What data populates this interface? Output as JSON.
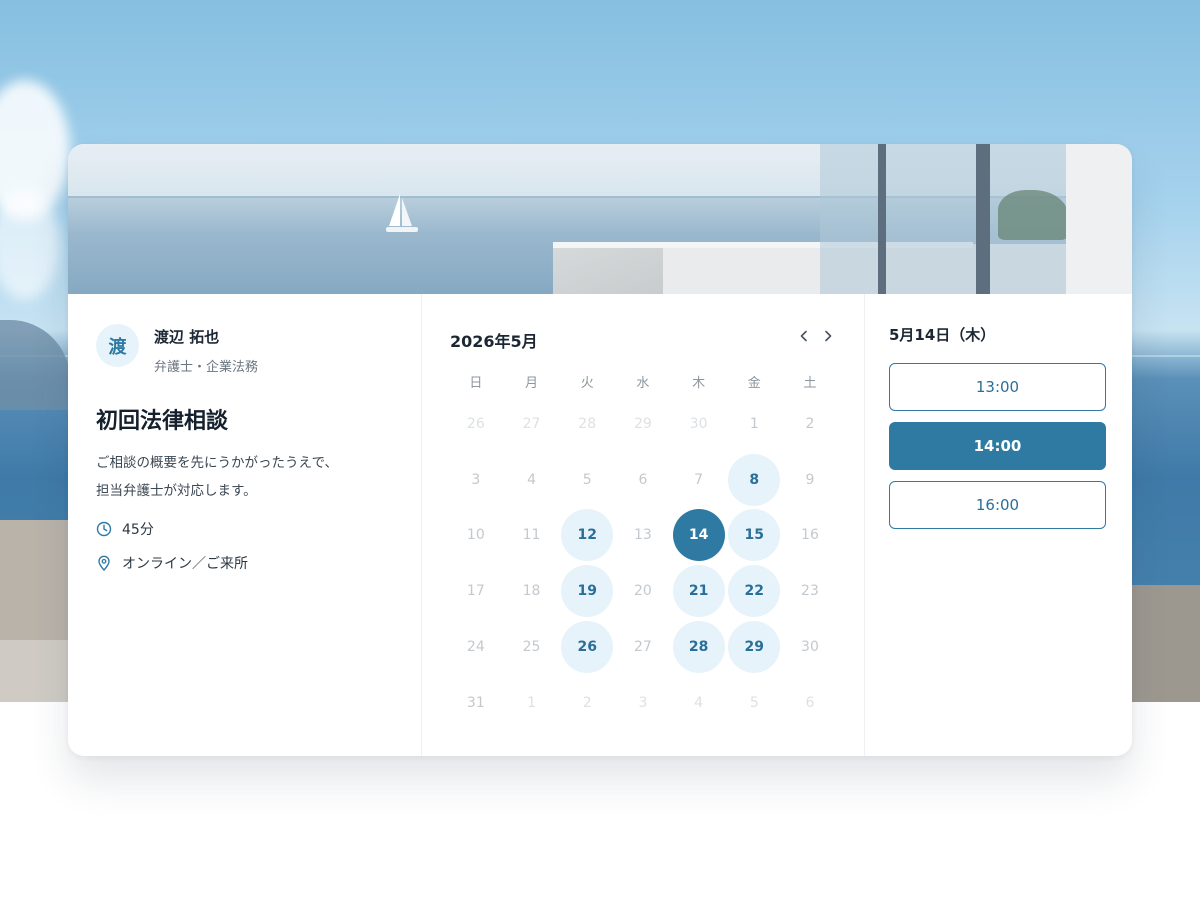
{
  "host": {
    "avatar_initial": "渡",
    "name": "渡辺 拓也",
    "role": "弁護士・企業法務"
  },
  "event": {
    "title": "初回法律相談",
    "description_line1": "ご相談の概要を先にうかがったうえで、",
    "description_line2": "担当弁護士が対応します。",
    "duration": "45分",
    "location": "オンライン／ご来所"
  },
  "calendar": {
    "month_label": "2026年5月",
    "weekdays": [
      "日",
      "月",
      "火",
      "水",
      "木",
      "金",
      "土"
    ],
    "weeks": [
      [
        {
          "d": "26",
          "s": "muted"
        },
        {
          "d": "27",
          "s": "muted"
        },
        {
          "d": "28",
          "s": "muted"
        },
        {
          "d": "29",
          "s": "muted"
        },
        {
          "d": "30",
          "s": "muted"
        },
        {
          "d": "1",
          "s": "off"
        },
        {
          "d": "2",
          "s": "off"
        }
      ],
      [
        {
          "d": "3",
          "s": "off"
        },
        {
          "d": "4",
          "s": "off"
        },
        {
          "d": "5",
          "s": "off"
        },
        {
          "d": "6",
          "s": "off"
        },
        {
          "d": "7",
          "s": "off"
        },
        {
          "d": "8",
          "s": "avail"
        },
        {
          "d": "9",
          "s": "off"
        }
      ],
      [
        {
          "d": "10",
          "s": "off"
        },
        {
          "d": "11",
          "s": "off"
        },
        {
          "d": "12",
          "s": "avail"
        },
        {
          "d": "13",
          "s": "off"
        },
        {
          "d": "14",
          "s": "selected"
        },
        {
          "d": "15",
          "s": "avail"
        },
        {
          "d": "16",
          "s": "off"
        }
      ],
      [
        {
          "d": "17",
          "s": "off"
        },
        {
          "d": "18",
          "s": "off"
        },
        {
          "d": "19",
          "s": "avail"
        },
        {
          "d": "20",
          "s": "off"
        },
        {
          "d": "21",
          "s": "avail"
        },
        {
          "d": "22",
          "s": "avail"
        },
        {
          "d": "23",
          "s": "off"
        }
      ],
      [
        {
          "d": "24",
          "s": "off"
        },
        {
          "d": "25",
          "s": "off"
        },
        {
          "d": "26",
          "s": "avail"
        },
        {
          "d": "27",
          "s": "off"
        },
        {
          "d": "28",
          "s": "avail"
        },
        {
          "d": "29",
          "s": "avail"
        },
        {
          "d": "30",
          "s": "off"
        }
      ],
      [
        {
          "d": "31",
          "s": "off"
        },
        {
          "d": "1",
          "s": "muted"
        },
        {
          "d": "2",
          "s": "muted"
        },
        {
          "d": "3",
          "s": "muted"
        },
        {
          "d": "4",
          "s": "muted"
        },
        {
          "d": "5",
          "s": "muted"
        },
        {
          "d": "6",
          "s": "muted"
        }
      ]
    ]
  },
  "slots": {
    "date_label": "5月14日（木）",
    "times": [
      {
        "label": "13:00",
        "active": false
      },
      {
        "label": "14:00",
        "active": true
      },
      {
        "label": "16:00",
        "active": false
      }
    ]
  },
  "colors": {
    "accent": "#2e7aa3",
    "available_bg": "#e6f3fa"
  },
  "icons": {
    "duration": "clock-icon",
    "location": "map-pin-icon",
    "prev": "chevron-left-icon",
    "next": "chevron-right-icon"
  }
}
